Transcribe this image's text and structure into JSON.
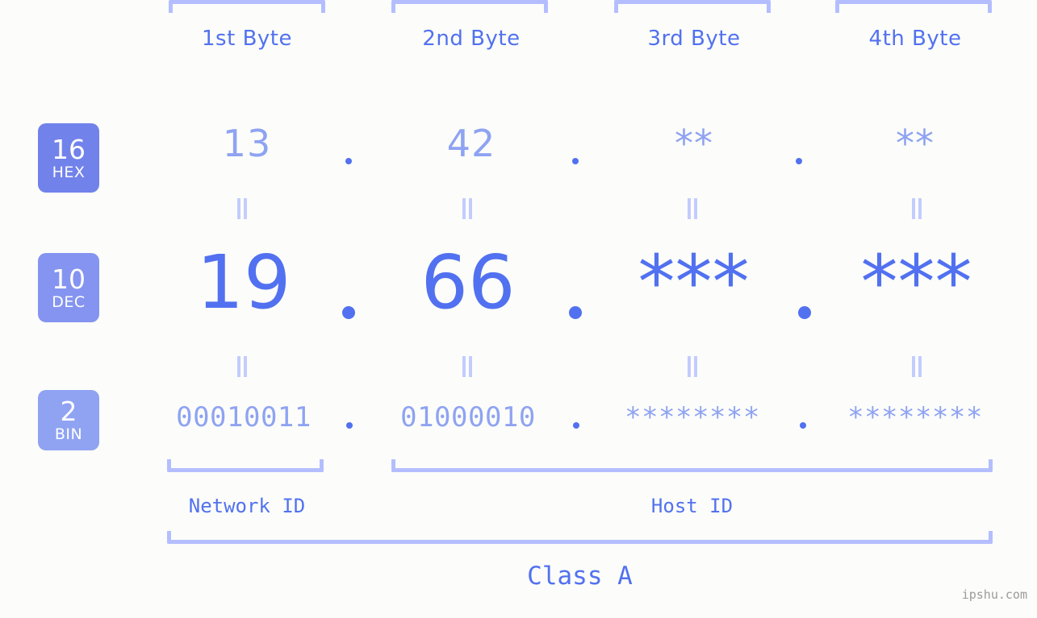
{
  "meta": {
    "background_color": "#fcfdfa",
    "accent_color": "#5271f0",
    "muted_accent_color": "#8fa3f2",
    "bracket_color": "#b4beff",
    "watermark": "ipshu.com"
  },
  "headers": {
    "byte1": "1st Byte",
    "byte2": "2nd Byte",
    "byte3": "3rd Byte",
    "byte4": "4th Byte"
  },
  "badges": [
    {
      "number": "16",
      "tag": "HEX",
      "color": "#7182ea"
    },
    {
      "number": "10",
      "tag": "DEC",
      "color": "#8494f0"
    },
    {
      "number": "2",
      "tag": "BIN",
      "color": "#8fa3f2"
    }
  ],
  "rows": {
    "hex": {
      "label": "HEX",
      "values": [
        "13",
        "42",
        "**",
        "**"
      ],
      "separator": "."
    },
    "dec": {
      "label": "DEC",
      "values": [
        "19",
        "66",
        "***",
        "***"
      ],
      "separator": "."
    },
    "bin": {
      "label": "BIN",
      "values": [
        "00010011",
        "01000010",
        "********",
        "********"
      ],
      "separator": "."
    }
  },
  "equals_separator": "||",
  "sections": {
    "network_id": "Network ID",
    "host_id": "Host ID",
    "class": "Class A"
  }
}
